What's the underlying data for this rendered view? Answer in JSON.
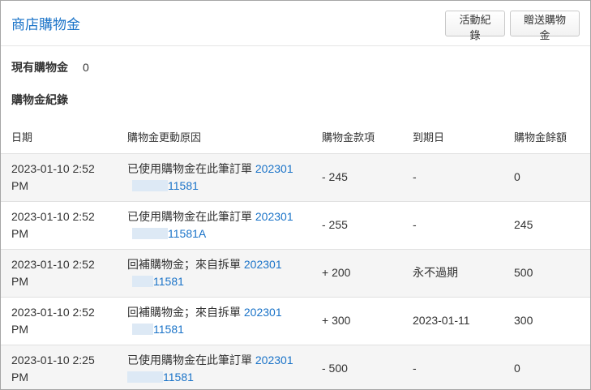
{
  "header": {
    "title": "商店購物金",
    "activity_button": "活動紀錄",
    "gift_button": "贈送購物金"
  },
  "summary": {
    "label": "現有購物金",
    "value": "0"
  },
  "records_heading": "購物金紀錄",
  "table": {
    "columns": [
      "日期",
      "購物金更動原因",
      "購物金款項",
      "到期日",
      "購物金餘額"
    ],
    "rows": [
      {
        "date_line1": "2023-01-10 2:52",
        "date_line2": "PM",
        "reason_text": "已使用購物金在此筆訂單",
        "order_prefix": "202301",
        "order_suffix": "11581",
        "amount": "- 245",
        "expiry": "-",
        "balance": "0"
      },
      {
        "date_line1": "2023-01-10 2:52",
        "date_line2": "PM",
        "reason_text": "已使用購物金在此筆訂單",
        "order_prefix": "202301",
        "order_suffix": "11581A",
        "amount": "- 255",
        "expiry": "-",
        "balance": "245"
      },
      {
        "date_line1": "2023-01-10 2:52",
        "date_line2": "PM",
        "reason_text": "回補購物金；來自拆單",
        "order_prefix": "202301",
        "order_suffix": "11581",
        "amount": "+ 200",
        "expiry": "永不過期",
        "balance": "500"
      },
      {
        "date_line1": "2023-01-10 2:52",
        "date_line2": "PM",
        "reason_text": "回補購物金；來自拆單",
        "order_prefix": "202301",
        "order_suffix": "11581",
        "amount": "+ 300",
        "expiry": "2023-01-11",
        "balance": "300"
      },
      {
        "date_line1": "2023-01-10 2:25",
        "date_line2": "PM",
        "reason_text": "已使用購物金在此筆訂單",
        "order_prefix": "202301",
        "order_suffix": "11581",
        "amount": "- 500",
        "expiry": "-",
        "balance": "0"
      }
    ]
  },
  "colors": {
    "accent": "#1a73c8",
    "row_stripe": "#f5f5f5",
    "border": "#e0e0e0"
  }
}
